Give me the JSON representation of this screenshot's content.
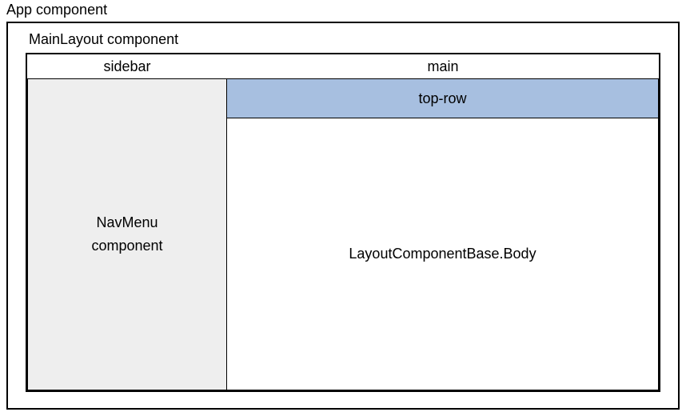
{
  "app": {
    "label": "App component"
  },
  "mainLayout": {
    "label": "MainLayout component"
  },
  "sidebar": {
    "header": "sidebar",
    "content": "NavMenu\ncomponent"
  },
  "main": {
    "header": "main",
    "topRow": "top-row",
    "body": "LayoutComponentBase.Body"
  }
}
